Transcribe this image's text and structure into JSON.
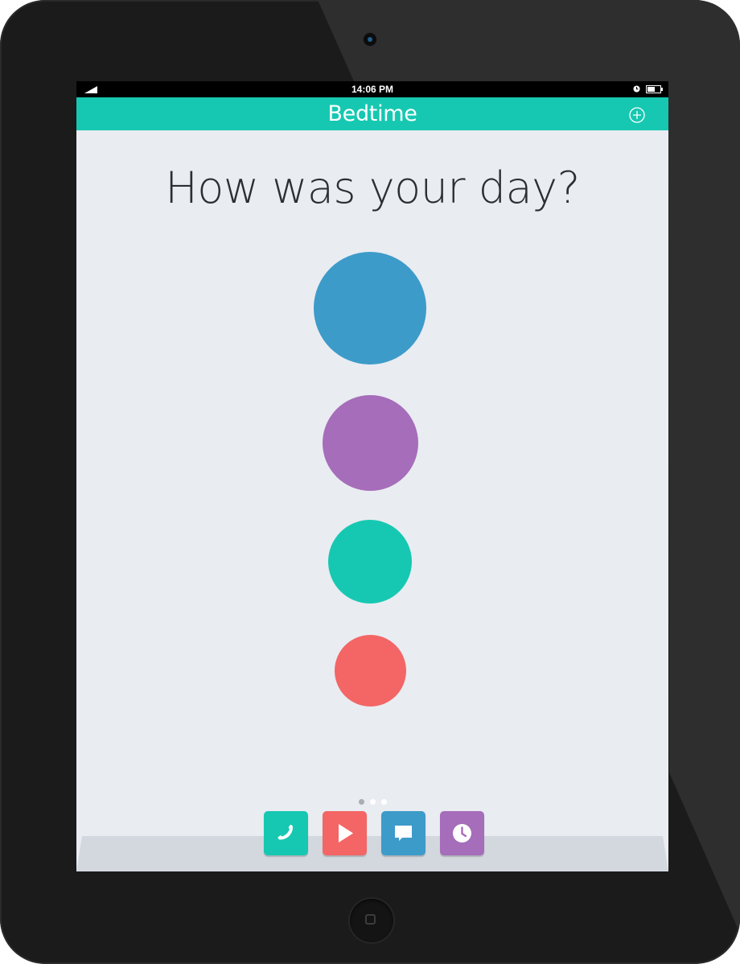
{
  "status_bar": {
    "time": "14:06 PM",
    "icons": [
      "signal-icon",
      "alarm-icon",
      "battery-icon"
    ]
  },
  "nav": {
    "title": "Bedtime",
    "add_icon": "plus-circle-icon"
  },
  "main": {
    "question": "How was your day?",
    "mood_options": [
      {
        "name": "mood-blue",
        "color": "#3d9bc9"
      },
      {
        "name": "mood-purple",
        "color": "#a66dba"
      },
      {
        "name": "mood-teal",
        "color": "#16c8b1"
      },
      {
        "name": "mood-coral",
        "color": "#f36665"
      }
    ]
  },
  "pager": {
    "count": 3,
    "active_index": 0
  },
  "dock": {
    "apps": [
      {
        "icon": "phone-icon",
        "color": "#16c8b1"
      },
      {
        "icon": "play-icon",
        "color": "#f36665"
      },
      {
        "icon": "chat-bubble-icon",
        "color": "#3d9bc9"
      },
      {
        "icon": "clock-icon",
        "color": "#a66dba"
      }
    ]
  },
  "colors": {
    "accent": "#16c8b1",
    "background": "#e9ecf1",
    "text": "#2b2e34",
    "device_frame": "#1b1b1b"
  }
}
